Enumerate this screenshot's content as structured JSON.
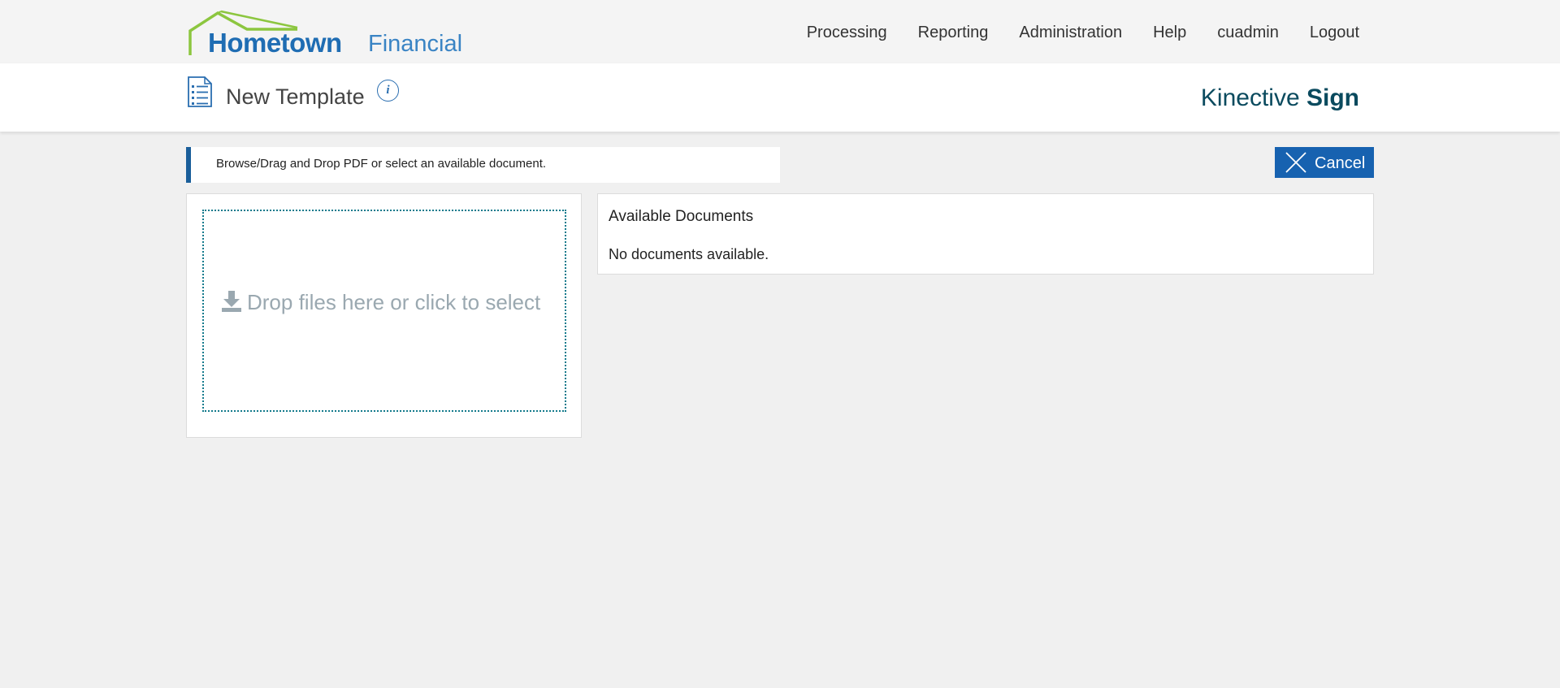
{
  "header": {
    "logo_main": "Hometown",
    "logo_sub": "Financial",
    "nav": [
      "Processing",
      "Reporting",
      "Administration",
      "Help",
      "cuadmin",
      "Logout"
    ]
  },
  "page": {
    "title": "New Template",
    "info_icon": "i",
    "brand_light": "Kinective",
    "brand_strong": "Sign"
  },
  "toolbar": {
    "instruction": "Browse/Drag and Drop PDF or select an available document.",
    "cancel_label": "Cancel"
  },
  "dropzone": {
    "text": "Drop files here or click to select"
  },
  "available_documents": {
    "title": "Available Documents",
    "empty_message": "No documents available."
  },
  "colors": {
    "page_background": "#f0f0f0",
    "accent_blue": "#1762b0",
    "logo_green": "#8cc63f",
    "brand_teal": "#0a4a5e",
    "dropzone_border": "#137a8c"
  },
  "icons": {
    "logo": "house-roof-logo",
    "page": "document-list-icon",
    "info": "info-icon",
    "cancel": "close-icon",
    "upload": "download-icon"
  }
}
